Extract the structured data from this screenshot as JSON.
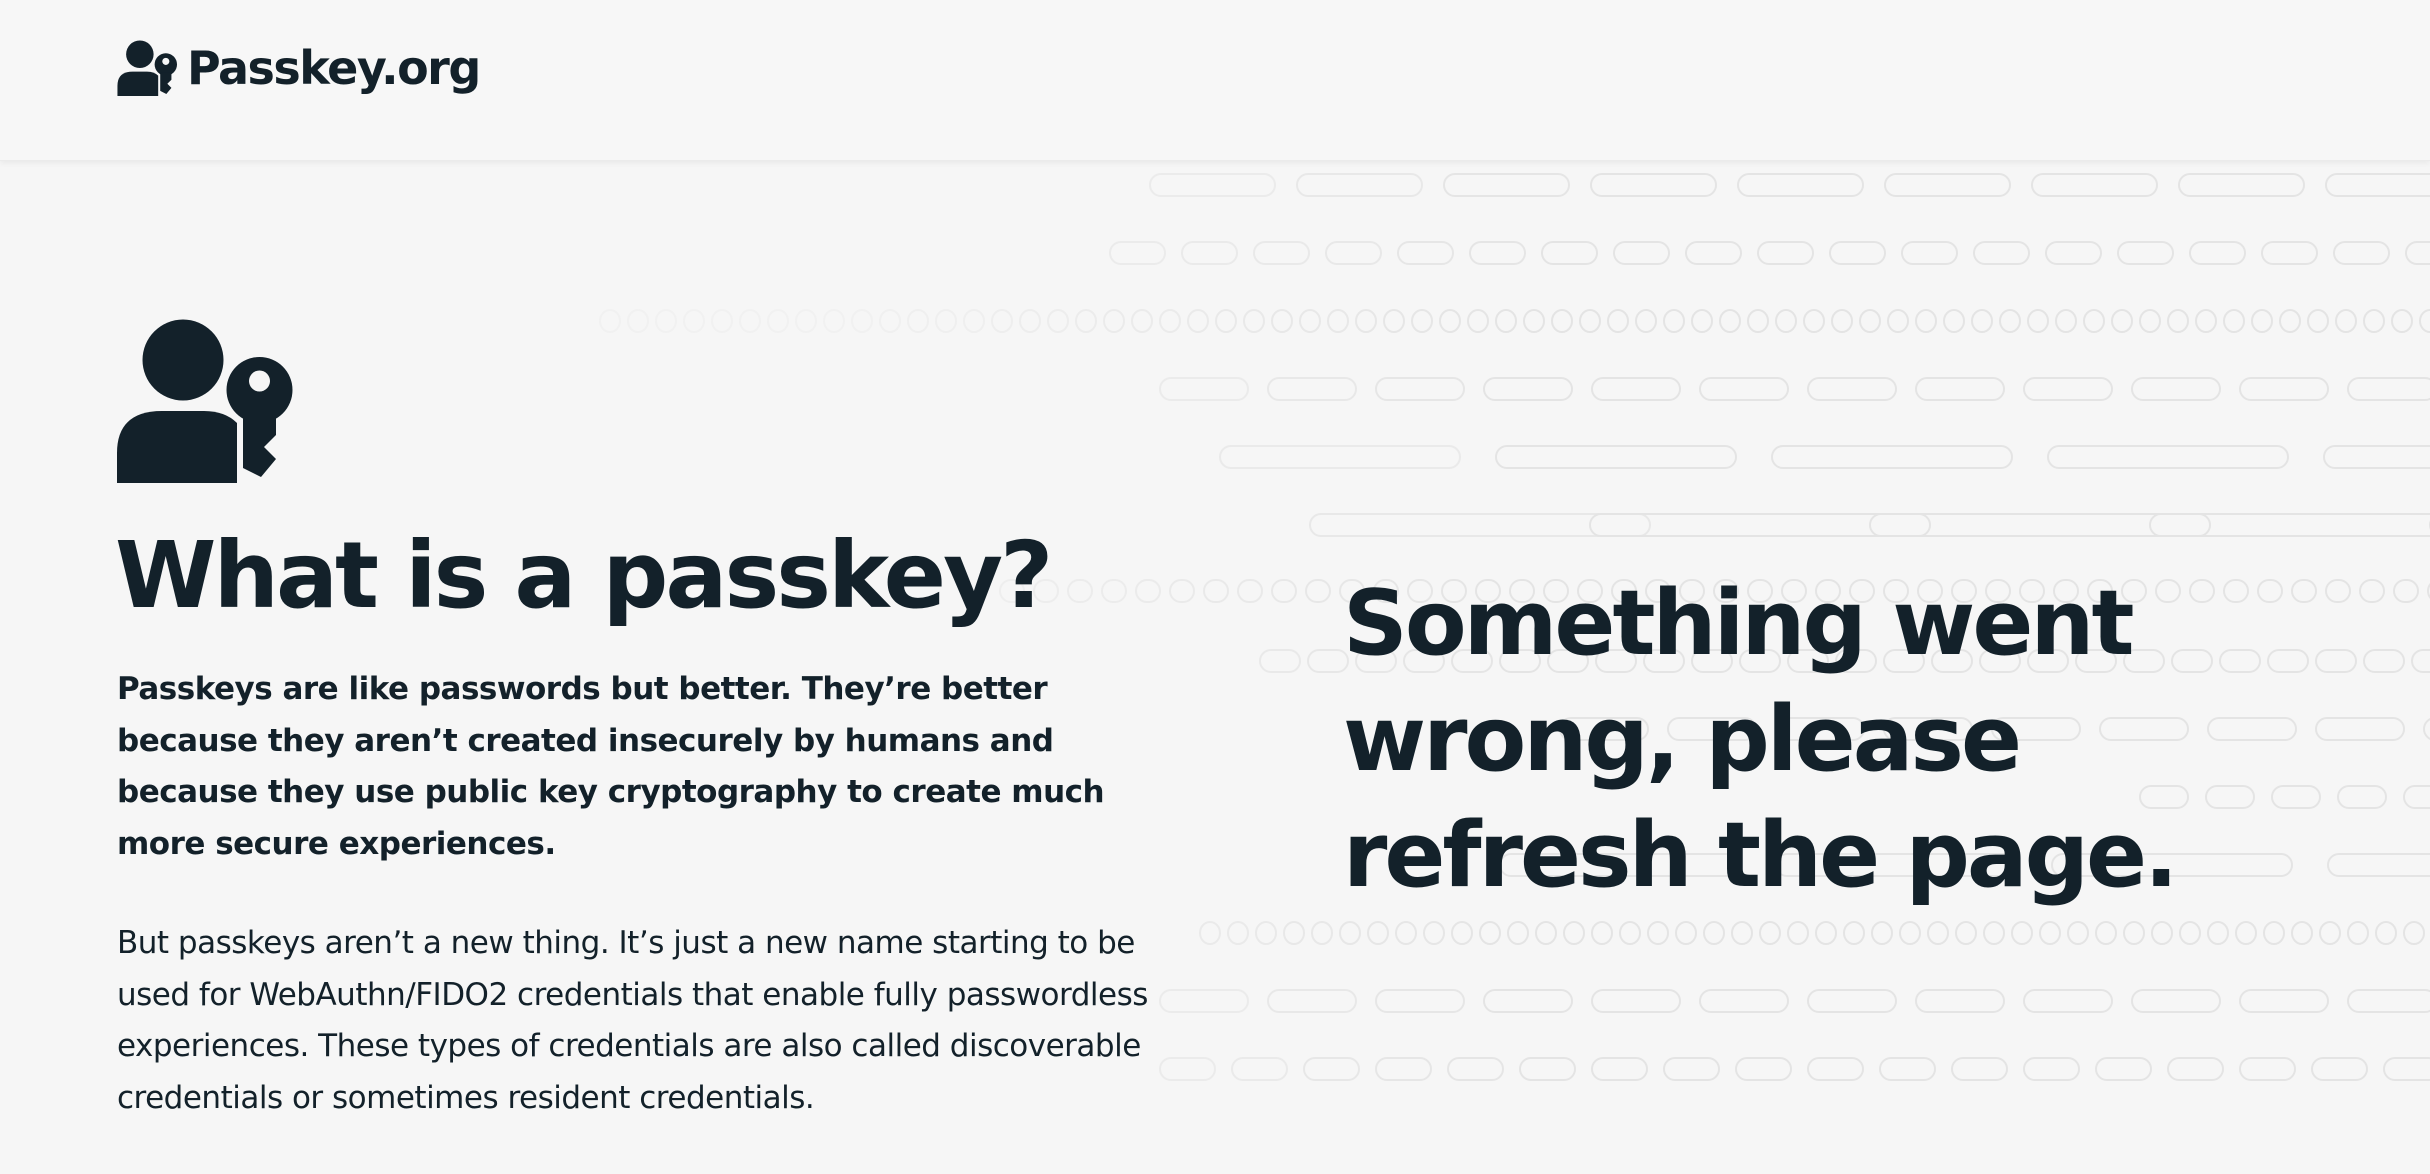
{
  "header": {
    "logo_text": "Passkey.org",
    "logo_icon": "user-key-icon"
  },
  "hero": {
    "icon": "user-key-icon",
    "heading": "What is a passkey?",
    "lead": "Passkeys are like passwords but better. They’re better because they aren’t created insecurely by humans and because they use public key cryptography to create much more secure experiences.",
    "body": "But passkeys aren’t a new thing. It’s just a new name starting to be used for WebAuthn/FIDO2 credentials that enable fully passwordless experiences. These types of credentials are also called discoverable credentials or sometimes resident credentials."
  },
  "error_message": "Something went wrong, please refresh the page.",
  "colors": {
    "text": "#13212a",
    "background": "#f6f6f6",
    "header_background": "#f7f7f7",
    "pattern_stroke": "#e4e4e4"
  }
}
